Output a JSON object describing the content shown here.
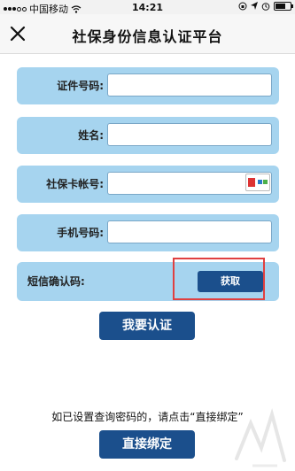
{
  "status_bar": {
    "carrier": "中国移动",
    "time": "14:21"
  },
  "nav": {
    "title": "社保身份信息认证平台"
  },
  "form": {
    "fields": [
      {
        "label": "证件号码:",
        "value": ""
      },
      {
        "label": "姓名:",
        "value": ""
      },
      {
        "label": "社保卡帐号:",
        "value": ""
      },
      {
        "label": "手机号码:",
        "value": ""
      }
    ],
    "sms_code": {
      "label": "短信确认码:",
      "button": "获取"
    }
  },
  "buttons": {
    "verify": "我要认证",
    "direct_bind": "直接绑定"
  },
  "hint": "如已设置查询密码的，请点击“直接绑定”",
  "colors": {
    "row_bg": "#a6d4ef",
    "button_bg": "#1b4f8c",
    "highlight": "#e04040"
  }
}
